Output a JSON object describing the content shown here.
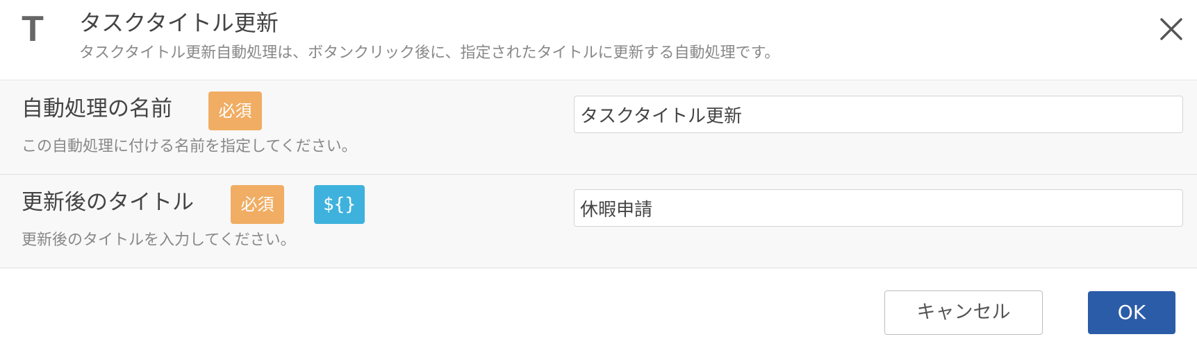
{
  "header": {
    "icon_glyph": "T",
    "icon_name": "text-title-icon",
    "title": "タスクタイトル更新",
    "description": "タスクタイトル更新自動処理は、ボタンクリック後に、指定されたタイトルに更新する自動処理です。",
    "close_icon": "close-icon"
  },
  "fields": {
    "name": {
      "label": "自動処理の名前",
      "required_badge": "必須",
      "hint": "この自動処理に付ける名前を指定してください。",
      "value": "タスクタイトル更新"
    },
    "new_title": {
      "label": "更新後のタイトル",
      "required_badge": "必須",
      "variable_badge": "${}",
      "hint": "更新後のタイトルを入力してください。",
      "value": "休暇申請"
    }
  },
  "footer": {
    "cancel_label": "キャンセル",
    "ok_label": "OK"
  },
  "colors": {
    "required_badge": "#f0ad63",
    "variable_badge": "#3eb2dd",
    "primary_button": "#2b5ca8",
    "row_background": "#f8f8f8"
  }
}
